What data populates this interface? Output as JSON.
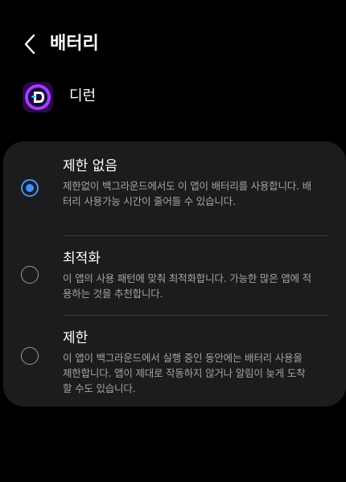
{
  "header": {
    "title": "배터리",
    "back_icon": "chevron-left-icon"
  },
  "app": {
    "name": "디런",
    "icon": "app-logo-icon",
    "icon_colors": [
      "#7a3cff",
      "#e040fb",
      "#1ad1ff"
    ]
  },
  "options": [
    {
      "title": "제한 없음",
      "description": "제한없이 백그라운드에서도 이 앱이 배터리를 사용합니다. 배터리 사용가능 시간이 줄어들 수 있습니다.",
      "selected": true
    },
    {
      "title": "최적화",
      "description": "이 앱의 사용 패턴에 맞춰 최적화합니다. 가능한 많은 앱에 적용하는 것을 추천합니다.",
      "selected": false
    },
    {
      "title": "제한",
      "description": "이 앱이 백그라운드에서 실행 중인 동안에는 배터리 사용을 제한합니다. 앱이 제대로 작동하지 않거나 알림이 늦게 도착할 수도 있습니다.",
      "selected": false
    }
  ],
  "colors": {
    "background": "#000000",
    "card": "#1c1c1e",
    "accent": "#3e91ff",
    "secondary_text": "#a4a4a6"
  }
}
